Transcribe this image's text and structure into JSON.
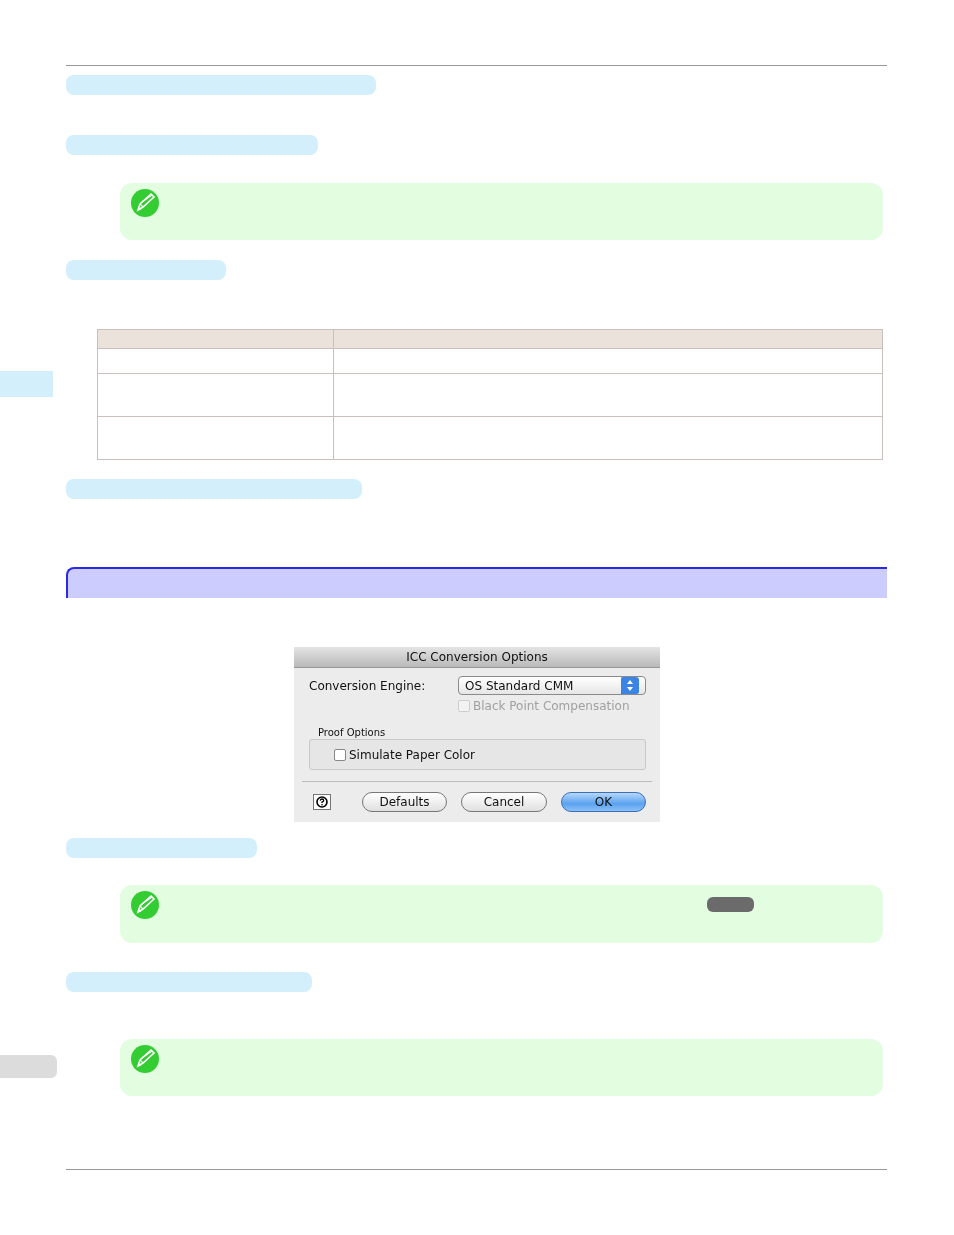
{
  "margin_tabs": [
    {
      "color": "#d3effc"
    },
    {
      "color": "#dcdcdc"
    }
  ],
  "blocks": [
    {
      "kind": "bar"
    },
    {
      "kind": "bar"
    },
    {
      "kind": "note",
      "badge": false
    },
    {
      "kind": "bar"
    },
    {
      "kind": "table",
      "rows": [
        {
          "kind": "short"
        },
        {
          "kind": "tall"
        },
        {
          "kind": "tall"
        }
      ]
    },
    {
      "kind": "bar"
    },
    {
      "kind": "section"
    },
    {
      "kind": "dialog"
    },
    {
      "kind": "bar"
    },
    {
      "kind": "note",
      "badge": true
    },
    {
      "kind": "bar"
    },
    {
      "kind": "note",
      "badge": false
    }
  ],
  "dialog": {
    "title": "ICC Conversion Options",
    "engine": {
      "label": "Conversion Engine:",
      "value": "OS Standard CMM"
    },
    "black_point": {
      "label": "Black Point Compensation",
      "checked": false,
      "disabled": true
    },
    "proof_options": {
      "label": "Proof Options",
      "simulate_paper_color": {
        "label": "Simulate Paper Color",
        "checked": false
      }
    },
    "buttons": [
      {
        "label": "Defaults",
        "default": false
      },
      {
        "label": "Cancel",
        "default": false
      },
      {
        "label": "OK",
        "default": true
      }
    ]
  }
}
